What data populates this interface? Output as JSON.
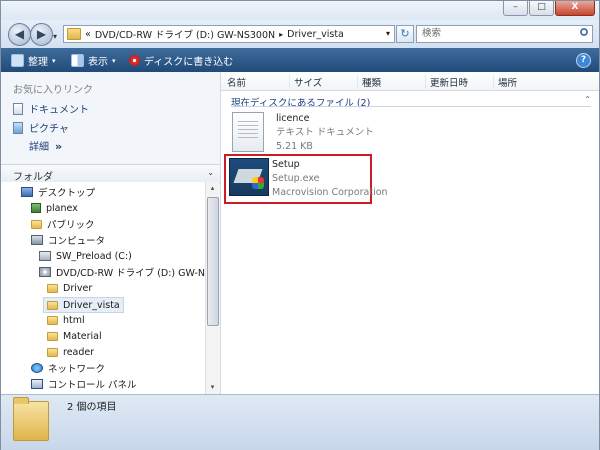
{
  "window": {
    "controls": {
      "minimize": "–",
      "maximize": "□",
      "close": "X"
    }
  },
  "navbar": {
    "back_glyph": "◀",
    "forward_glyph": "▶",
    "history_glyph": "▾",
    "address_prefix": "«",
    "address_crumbs": [
      "DVD/CD-RW ドライブ (D:) GW-NS300N",
      "Driver_vista"
    ],
    "crumb_separator": "▸",
    "address_dropdown": "▾",
    "refresh_glyph": "↻",
    "search_placeholder": "検索"
  },
  "toolbar": {
    "organize": "整理",
    "views": "表示",
    "burn": "ディスクに書き込む",
    "dropdown_glyph": "▾",
    "help": "?"
  },
  "sidebar": {
    "favorites_title": "お気に入りリンク",
    "favorites": [
      "ドキュメント",
      "ピクチャ"
    ],
    "more": "詳細",
    "more_glyph": "»",
    "folders_title": "フォルダ",
    "folders_chevron": "⌄",
    "tree": [
      {
        "label": "デスクトップ",
        "icon": "desktop-icon"
      },
      {
        "label": "planex",
        "icon": "user-icon"
      },
      {
        "label": "パブリック",
        "icon": "folder-icon"
      },
      {
        "label": "コンピュータ",
        "icon": "computer-icon"
      },
      {
        "label": "SW_Preload (C:)",
        "icon": "drive-icon"
      },
      {
        "label": "DVD/CD-RW ドライブ (D:) GW-N",
        "icon": "dvd-drive-icon"
      },
      {
        "label": "Driver",
        "icon": "folder-icon"
      },
      {
        "label": "Driver_vista",
        "icon": "folder-icon",
        "selected": true
      },
      {
        "label": "html",
        "icon": "folder-icon"
      },
      {
        "label": "Material",
        "icon": "folder-icon"
      },
      {
        "label": "reader",
        "icon": "folder-icon"
      },
      {
        "label": "ネットワーク",
        "icon": "network-icon"
      },
      {
        "label": "コントロール パネル",
        "icon": "control-panel-icon"
      }
    ],
    "scroll_up": "▴",
    "scroll_down": "▾"
  },
  "main": {
    "columns": [
      "名前",
      "サイズ",
      "種類",
      "更新日時",
      "場所"
    ],
    "group_header": "現在ディスクにあるファイル (2)",
    "group_chevron": "⌃",
    "files": [
      {
        "name": "licence",
        "type": "テキスト ドキュメント",
        "detail": "5.21 KB",
        "icon": "text-document-icon"
      },
      {
        "name": "Setup",
        "type": "Setup.exe",
        "detail": "Macrovision Corporation",
        "icon": "setup-installer-icon",
        "highlighted": true
      }
    ]
  },
  "statusbar": {
    "text": "2 個の項目"
  },
  "colors": {
    "toolbar": "#2a5887",
    "highlight": "#cc1c28",
    "link": "#1f3f7a"
  }
}
